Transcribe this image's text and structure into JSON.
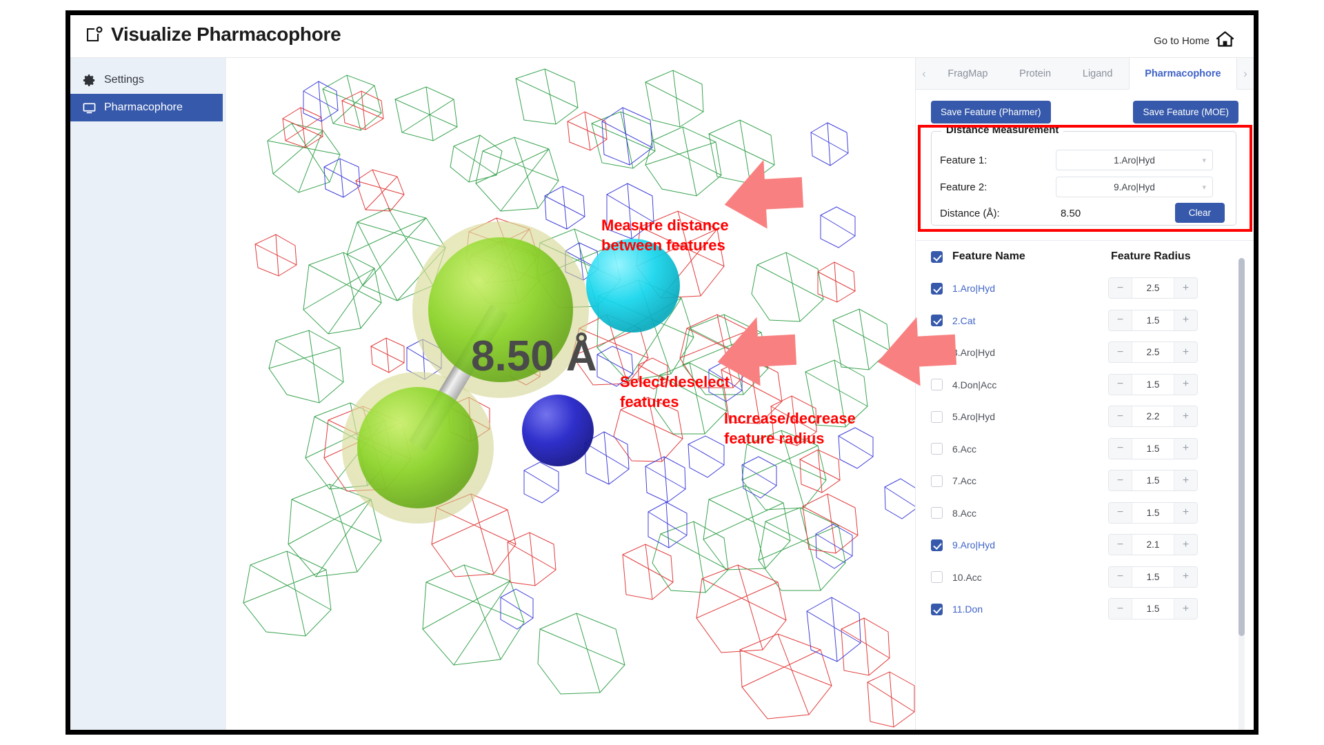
{
  "header": {
    "title": "Visualize Pharmacophore",
    "app_icon": "screenshot-frame-icon",
    "home_label": "Go to Home",
    "home_icon": "home-icon"
  },
  "sidebar": {
    "items": [
      {
        "label": "Settings",
        "icon": "gear-icon",
        "active": false
      },
      {
        "label": "Pharmacophore",
        "icon": "monitor-icon",
        "active": true
      }
    ]
  },
  "tabs": {
    "prev_icon": "chevron-left-icon",
    "next_icon": "chevron-right-icon",
    "items": [
      {
        "label": "FragMap",
        "active": false
      },
      {
        "label": "Protein",
        "active": false
      },
      {
        "label": "Ligand",
        "active": false
      },
      {
        "label": "Pharmacophore",
        "active": true
      }
    ]
  },
  "toolbar": {
    "save_pharmer_label": "Save Feature (Pharmer)",
    "save_moe_label": "Save Feature (MOE)"
  },
  "distance_measurement": {
    "legend": "Distance Measurement",
    "feature1_label": "Feature 1:",
    "feature1_value": "1.Aro|Hyd",
    "feature2_label": "Feature 2:",
    "feature2_value": "9.Aro|Hyd",
    "distance_label": "Distance (Å):",
    "distance_value": "8.50",
    "clear_label": "Clear",
    "highlight_color": "#ff0000"
  },
  "feature_table": {
    "select_all_checked": true,
    "col_name": "Feature Name",
    "col_radius": "Feature Radius",
    "minus_label": "−",
    "plus_label": "+",
    "rows": [
      {
        "name": "1.Aro|Hyd",
        "checked": true,
        "radius": "2.5"
      },
      {
        "name": "2.Cat",
        "checked": true,
        "radius": "1.5"
      },
      {
        "name": "3.Aro|Hyd",
        "checked": false,
        "radius": "2.5"
      },
      {
        "name": "4.Don|Acc",
        "checked": false,
        "radius": "1.5"
      },
      {
        "name": "5.Aro|Hyd",
        "checked": false,
        "radius": "2.2"
      },
      {
        "name": "6.Acc",
        "checked": false,
        "radius": "1.5"
      },
      {
        "name": "7.Acc",
        "checked": false,
        "radius": "1.5"
      },
      {
        "name": "8.Acc",
        "checked": false,
        "radius": "1.5"
      },
      {
        "name": "9.Aro|Hyd",
        "checked": true,
        "radius": "2.1"
      },
      {
        "name": "10.Acc",
        "checked": false,
        "radius": "1.5"
      },
      {
        "name": "11.Don",
        "checked": true,
        "radius": "1.5"
      }
    ]
  },
  "viewport": {
    "distance_label": "8.50 Å",
    "spheres": [
      {
        "name": "aromatic-hydrophobic-sphere-top",
        "color": "#7ed321"
      },
      {
        "name": "aromatic-hydrophobic-sphere-bottom",
        "color": "#7ed321"
      },
      {
        "name": "acceptor-sphere-cyan",
        "color": "#00d2e6"
      },
      {
        "name": "donor-sphere-blue",
        "color": "#2a2ad0"
      }
    ],
    "fragmap_colors": {
      "green": "#2e9e46",
      "red": "#e03030",
      "blue": "#3636d8"
    }
  },
  "annotations": [
    {
      "text": "Measure distance\nbetween features",
      "arrow": "up-right-arrow"
    },
    {
      "text": "Select/deselect\nfeatures",
      "arrow": "up-right-arrow"
    },
    {
      "text": "Increase/decrease\nfeature radius",
      "arrow": "up-right-arrow"
    }
  ]
}
